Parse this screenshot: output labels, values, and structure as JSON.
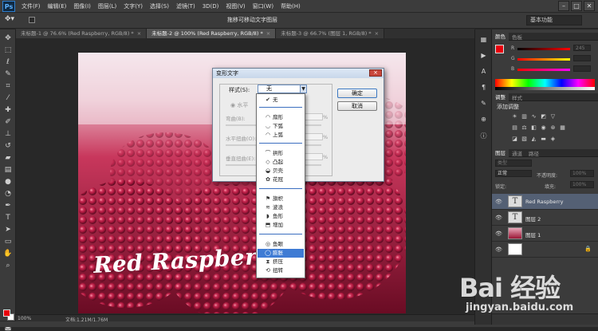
{
  "app": {
    "logo": "Ps"
  },
  "menu": [
    "文件(F)",
    "编辑(E)",
    "图像(I)",
    "图层(L)",
    "文字(Y)",
    "选择(S)",
    "滤镜(T)",
    "3D(D)",
    "视图(V)",
    "窗口(W)",
    "帮助(H)"
  ],
  "window_controls": [
    "–",
    "□",
    "✕"
  ],
  "options_bar": {
    "title": "拖移可移动文字图层",
    "workspace": "基本功能"
  },
  "tabs": [
    {
      "label": "未标题-1 @ 76.6% (Red Raspberry, RGB/8) *",
      "close": "×"
    },
    {
      "label": "未标题-2 @ 100% (Red Raspberry, RGB/8) *",
      "close": "×"
    },
    {
      "label": "未标题-3 @ 66.7% (图层 1, RGB/8) *",
      "close": "×"
    }
  ],
  "canvas": {
    "text": "Red Raspberry"
  },
  "status": {
    "zoom": "100%",
    "doc_size": "文档:1.21M/1.76M"
  },
  "dialog": {
    "title": "变形文字",
    "close": "×",
    "style_label": "样式(S):",
    "style_value": "无",
    "orientation": "◉ 水平",
    "bend_label": "弯曲(B):",
    "hdist_label": "水平扭曲(O):",
    "vdist_label": "垂直扭曲(E):",
    "pct": "%",
    "ok": "确定",
    "cancel": "取消"
  },
  "dropdown": {
    "items": [
      {
        "icon": "✔",
        "label": "无"
      },
      {
        "icon": "◠",
        "label": "扇形"
      },
      {
        "icon": "◡",
        "label": "下弧"
      },
      {
        "icon": "◠",
        "label": "上弧"
      },
      {
        "icon": "⌒",
        "label": "拱形"
      },
      {
        "icon": "◇",
        "label": "凸起"
      },
      {
        "icon": "◒",
        "label": "贝壳"
      },
      {
        "icon": "✿",
        "label": "花冠"
      },
      {
        "icon": "⚑",
        "label": "旗帜"
      },
      {
        "icon": "≋",
        "label": "波浪"
      },
      {
        "icon": "◗",
        "label": "鱼形"
      },
      {
        "icon": "⬒",
        "label": "增加"
      },
      {
        "icon": "◎",
        "label": "鱼眼"
      },
      {
        "icon": "◯",
        "label": "膨胀"
      },
      {
        "icon": "⧗",
        "label": "挤压"
      },
      {
        "icon": "⟲",
        "label": "扭转"
      }
    ],
    "selected_index": 13
  },
  "color_panel": {
    "tabs": [
      "颜色",
      "色板"
    ],
    "r_label": "R",
    "g_label": "G",
    "b_label": "B",
    "r_value": "245",
    "g_value": "",
    "b_value": ""
  },
  "adjust_panel": {
    "tabs": [
      "调整",
      "样式"
    ],
    "title": "添加调整"
  },
  "layers_panel": {
    "tabs": [
      "图层",
      "通道",
      "路径"
    ],
    "filter": "类型",
    "blend_mode": "正常",
    "opacity_label": "不透明度:",
    "opacity_value": "100%",
    "lock_label": "锁定:",
    "fill_label": "填充:",
    "fill_value": "100%",
    "layers": [
      {
        "thumb": "T",
        "name": "Red Raspberry",
        "selected": true
      },
      {
        "thumb": "T",
        "name": "图层 2",
        "selected": false
      },
      {
        "thumb": "",
        "name": "图层 1",
        "selected": false
      },
      {
        "thumb": "",
        "name": "",
        "selected": false
      }
    ]
  },
  "watermark": {
    "logo": "Bai 经验",
    "url": "jingyan.baidu.com"
  },
  "colors": {
    "foreground": "#e8000b",
    "background": "#ffffff",
    "selection": "#3e7bd4"
  }
}
